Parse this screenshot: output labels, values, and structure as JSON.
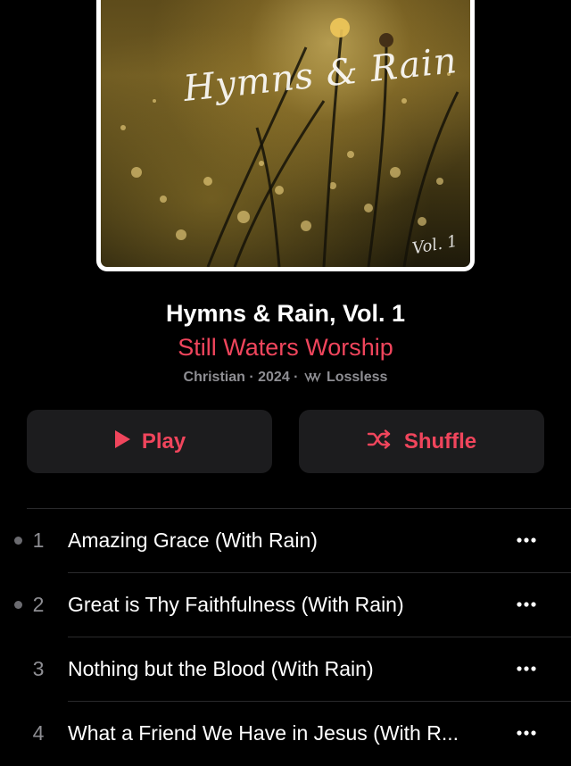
{
  "artwork": {
    "script_title": "Hymns & Rain",
    "vol_mark": "Vol. 1"
  },
  "album": {
    "title": "Hymns & Rain, Vol. 1",
    "artist": "Still Waters Worship",
    "genre": "Christian",
    "year": "2024",
    "quality": "Lossless",
    "separator": "·"
  },
  "buttons": {
    "play_label": "Play",
    "shuffle_label": "Shuffle"
  },
  "colors": {
    "accent": "#f0455c",
    "background": "#000000",
    "button_bg": "#1c1c1e",
    "secondary_text": "#8e8e93"
  },
  "tracks": [
    {
      "number": "1",
      "title": "Amazing Grace (With Rain)",
      "has_dot": true
    },
    {
      "number": "2",
      "title": "Great is Thy Faithfulness (With Rain)",
      "has_dot": true
    },
    {
      "number": "3",
      "title": "Nothing but the Blood (With Rain)",
      "has_dot": false
    },
    {
      "number": "4",
      "title": "What a Friend We Have in Jesus (With R...",
      "has_dot": false
    }
  ],
  "icons": {
    "play": "play-icon",
    "shuffle": "shuffle-icon",
    "more": "more-ellipsis-icon",
    "lossless": "lossless-icon"
  }
}
